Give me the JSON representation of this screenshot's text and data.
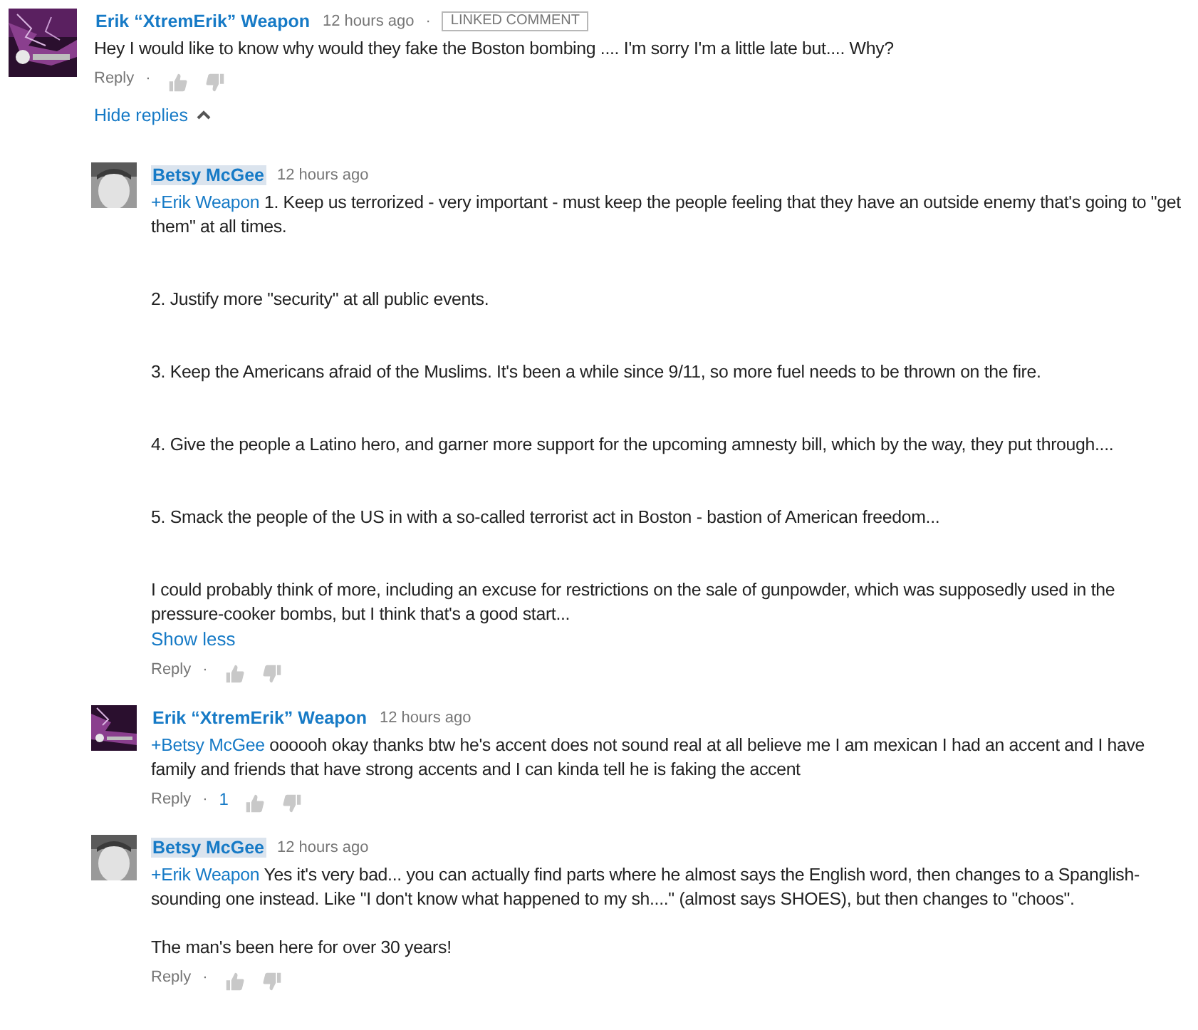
{
  "comment": {
    "author": "Erik “XtremErik” Weapon",
    "highlighted": false,
    "time": "12 hours ago",
    "badge": "LINKED COMMENT",
    "text": "Hey I would like to know why would they fake the Boston bombing .... I'm sorry I'm a little late but.... Why?",
    "reply_label": "Reply",
    "separator": "·",
    "toggle": "Hide replies",
    "expanded": true
  },
  "replies": [
    {
      "author": "Betsy McGee",
      "highlighted": true,
      "time": "12 hours ago",
      "mention": "+Erik Weapon",
      "text": "1.  Keep us terrorized - very important - must keep the people feeling that they have an outside enemy that's going to \"get them\" at all times.\n\n\n2.  Justify more \"security\" at all public events.\n\n\n3.  Keep the Americans afraid of the Muslims.  It's been a while since 9/11, so more fuel needs to be thrown on the fire.\n\n\n4.  Give the people a Latino hero, and garner more support for the upcoming amnesty bill, which by the way, they put through....\n\n\n5.  Smack the people of the US in with a so-called terrorist act in Boston - bastion of American freedom...\n\n\nI could probably think of more, including an excuse for restrictions on the sale of gunpowder, which was supposedly used in the pressure-cooker bombs, but I think that's a good start...",
      "show_less": "Show less",
      "reply_label": "Reply",
      "separator": "·"
    },
    {
      "author": "Erik “XtremErik” Weapon",
      "highlighted": false,
      "time": "12 hours ago",
      "mention": "+Betsy McGee",
      "text": "oooooh okay thanks btw he's accent does not sound real at all believe me I am mexican I had an accent and I have family and friends that have strong accents and I can kinda tell he is faking the accent",
      "reply_label": "Reply",
      "separator": "·",
      "likes": "1"
    },
    {
      "author": "Betsy McGee",
      "highlighted": true,
      "time": "12 hours ago",
      "mention": "+Erik Weapon",
      "text": "Yes it's very bad... you can actually find parts where he almost says the English word, then changes to a Spanglish-sounding one instead.  Like \"I don't know what happened to my sh....\" (almost says SHOES), but then changes to \"choos\".\n\nThe man's been here for over 30 years!",
      "reply_label": "Reply",
      "separator": "·"
    }
  ]
}
